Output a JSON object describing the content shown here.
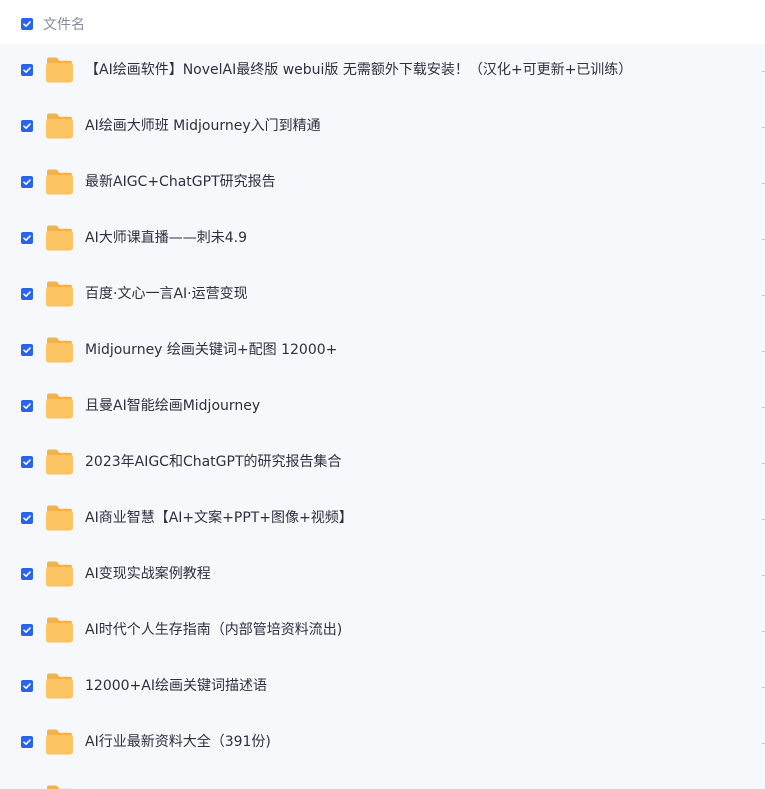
{
  "header": {
    "column_label": "文件名",
    "select_all_checked": true
  },
  "icons": {
    "checkbox": "check-icon",
    "folder": "folder-icon"
  },
  "colors": {
    "checkbox_accent": "#2864f0",
    "folder_body": "#fcc462",
    "folder_tab": "#f5b24a",
    "row_background": "#f7f8fc",
    "header_text": "#878c9c",
    "row_text": "#2d3040"
  },
  "rows": [
    {
      "name": "【AI绘画软件】NovelAI最终版 webui版 无需额外下载安装！（汉化+可更新+已训练）",
      "checked": true
    },
    {
      "name": "AI绘画大师班 Midjourney入门到精通",
      "checked": true
    },
    {
      "name": "最新AIGC+ChatGPT研究报告",
      "checked": true
    },
    {
      "name": "AI大师课直播——刺未4.9",
      "checked": true
    },
    {
      "name": "百度·文心一言AI·运营变现",
      "checked": true
    },
    {
      "name": "Midjourney 绘画关键词+配图 12000+",
      "checked": true
    },
    {
      "name": "且曼AI智能绘画Midjourney",
      "checked": true
    },
    {
      "name": "2023年AIGC和ChatGPT的研究报告集合",
      "checked": true
    },
    {
      "name": "AI商业智慧【AI+文案+PPT+图像+视频】",
      "checked": true
    },
    {
      "name": "AI变现实战案例教程",
      "checked": true
    },
    {
      "name": "AI时代个人生存指南（内部管培资料流出)",
      "checked": true
    },
    {
      "name": "12000+AI绘画关键词描述语",
      "checked": true
    },
    {
      "name": "AI行业最新资料大全（391份)",
      "checked": true
    },
    {
      "name": "",
      "checked": true
    }
  ]
}
